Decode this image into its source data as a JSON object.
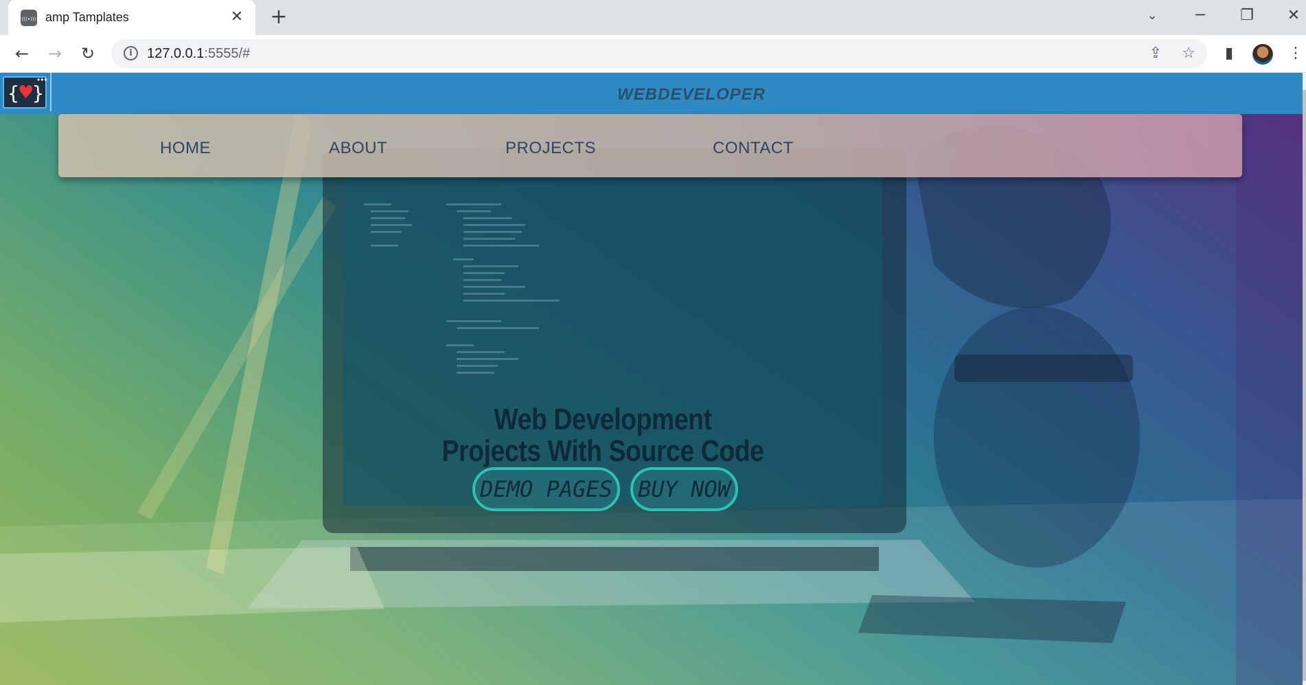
{
  "browser": {
    "tab": {
      "title": "amp Tamplates"
    },
    "new_tab_symbol": "+",
    "address": {
      "host": "127.0.0.1",
      "rest": ":5555/#"
    }
  },
  "icons": {
    "favicon": "(((•)))",
    "close": "✕",
    "back": "←",
    "forward": "→",
    "reload": "↻",
    "info": "i",
    "share": "⇪",
    "star": "☆",
    "sidepanel": "▮",
    "menu": "⋮",
    "tab_search": "⌄",
    "minimize": "─",
    "restore": "❐",
    "window_close": "✕"
  },
  "page": {
    "logo": {
      "open_brace": "{",
      "close_brace": "}",
      "heart": "♥",
      "dots": "•••"
    },
    "site_title": "WEBDEVELOPER",
    "nav": [
      "HOME",
      "ABOUT",
      "PROJECTS",
      "CONTACT"
    ],
    "hero": {
      "line1": "Web Development",
      "line2": "Projects With Source Code",
      "buttons": [
        "DEMO PAGES",
        "BUY NOW"
      ]
    }
  }
}
